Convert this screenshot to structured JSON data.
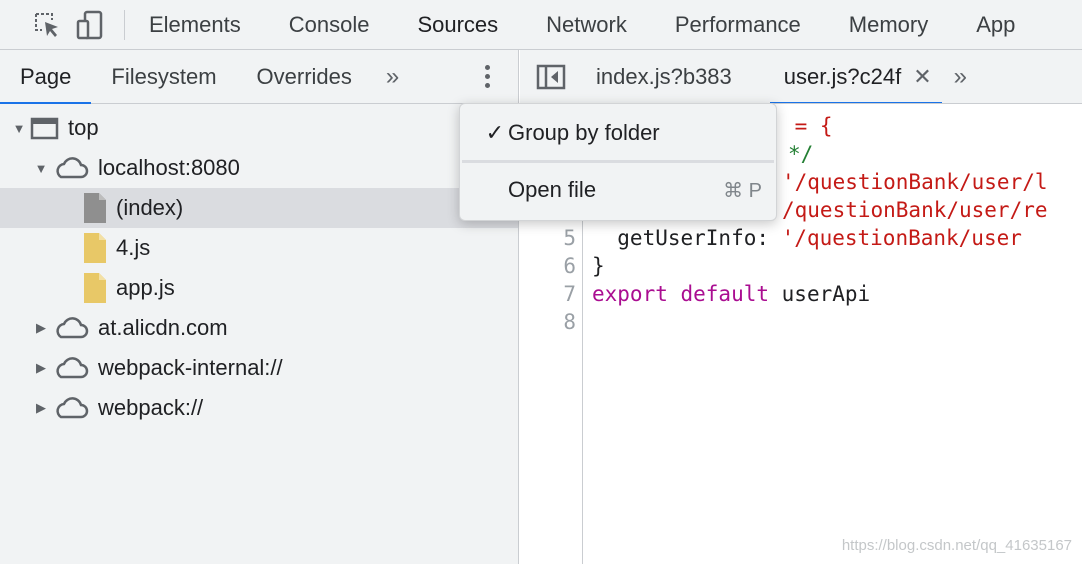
{
  "toolbar": {
    "icons": [
      "inspect-element-icon",
      "device-toggle-icon"
    ],
    "tabs": [
      {
        "label": "Elements"
      },
      {
        "label": "Console"
      },
      {
        "label": "Sources"
      },
      {
        "label": "Network"
      },
      {
        "label": "Performance"
      },
      {
        "label": "Memory"
      },
      {
        "label": "App"
      }
    ],
    "active_tab": "Sources"
  },
  "navigator": {
    "tabs": [
      {
        "label": "Page"
      },
      {
        "label": "Filesystem"
      },
      {
        "label": "Overrides"
      }
    ],
    "more_label": "»",
    "tree": [
      {
        "label": "top",
        "icon": "frame-icon"
      },
      {
        "label": "localhost:8080",
        "icon": "cloud-icon"
      },
      {
        "label": "(index)",
        "icon": "document-icon"
      },
      {
        "label": "4.js",
        "icon": "js-file-icon"
      },
      {
        "label": "app.js",
        "icon": "js-file-icon"
      },
      {
        "label": "at.alicdn.com",
        "icon": "cloud-icon"
      },
      {
        "label": "webpack-internal://",
        "icon": "cloud-icon"
      },
      {
        "label": "webpack://",
        "icon": "cloud-icon"
      }
    ]
  },
  "editor": {
    "tabs": [
      {
        "label": "index.js?b383"
      },
      {
        "label": "user.js?c24f",
        "close": "✕"
      }
    ],
    "more_label": "»",
    "lines": [
      {
        "n": "",
        "a": "",
        "b": "",
        "c": ""
      },
      {
        "n": "",
        "a": "",
        "b": "",
        "c": ""
      },
      {
        "n": "",
        "a": "",
        "b": "",
        "c": ""
      },
      {
        "n": "",
        "a": "",
        "b": "",
        "c": ""
      },
      {
        "n": "5",
        "a": "  getUserInfo: ",
        "b": "'/questionBank/user",
        "c": ""
      },
      {
        "n": "6",
        "a": "}",
        "b": "",
        "c": ""
      },
      {
        "n": "7",
        "a": "",
        "kw": "export default",
        "c": " userApi"
      },
      {
        "n": "8",
        "a": "",
        "b": "",
        "c": ""
      }
    ],
    "fragments": {
      "line1": " = {",
      "line2": "*/",
      "line3": "'/questionBank/user/l",
      "line4": "/questionBank/user/re"
    }
  },
  "context_menu": {
    "items": [
      {
        "check": "✓",
        "label": "Group by folder"
      },
      {
        "label": "Open file",
        "shortcut": "⌘ P"
      }
    ]
  },
  "watermark": "https://blog.csdn.net/qq_41635167"
}
